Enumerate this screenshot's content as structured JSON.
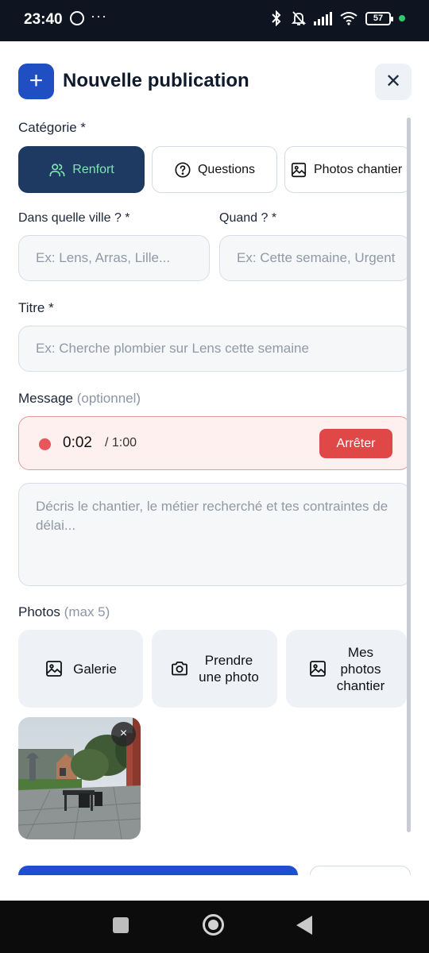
{
  "status_bar": {
    "time": "23:40",
    "dots": "···",
    "battery": "57"
  },
  "header": {
    "plus_icon": "+",
    "title": "Nouvelle publication",
    "close_icon": "✕"
  },
  "category": {
    "label": "Catégorie *",
    "options": [
      {
        "label": "Renfort",
        "icon": "users-icon",
        "selected": true
      },
      {
        "label": "Questions",
        "icon": "question-circle-icon",
        "selected": false
      },
      {
        "label": "Photos chantier",
        "icon": "image-icon",
        "selected": false
      }
    ]
  },
  "city": {
    "label": "Dans quelle ville ? *",
    "placeholder": "Ex: Lens, Arras, Lille..."
  },
  "when": {
    "label": "Quand ? *",
    "placeholder": "Ex: Cette semaine, Urgent"
  },
  "title_field": {
    "label": "Titre *",
    "placeholder": "Ex: Cherche plombier sur Lens cette semaine"
  },
  "message": {
    "label": "Message",
    "optional": "(optionnel)",
    "recording": {
      "elapsed": "0:02",
      "max": "/ 1:00",
      "stop_label": "Arrêter"
    },
    "placeholder": "Décris le chantier, le métier recherché et tes contraintes de délai..."
  },
  "photos": {
    "label": "Photos",
    "max": "(max 5)",
    "buttons": {
      "gallery": "Galerie",
      "camera_line1": "Prendre",
      "camera_line2": "une photo",
      "mine_line1": "Mes",
      "mine_line2": "photos",
      "mine_line3": "chantier"
    },
    "thumbnail_remove": "×"
  },
  "colors": {
    "accent": "#1f4fc2",
    "chip_active_bg": "#1e3a63",
    "chip_active_text": "#7fe3b2",
    "recording_red": "#e04848"
  }
}
